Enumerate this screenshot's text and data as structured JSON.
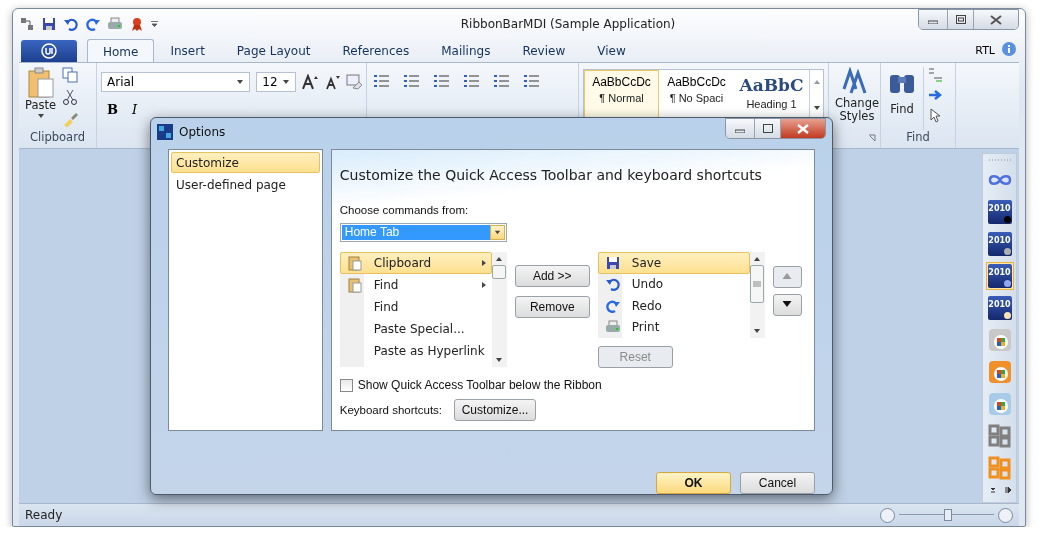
{
  "window": {
    "title": "RibbonBarMDI (Sample Application)"
  },
  "quick_access": [
    {
      "kind": "app"
    },
    {
      "kind": "save"
    },
    {
      "kind": "undo"
    },
    {
      "kind": "redo"
    },
    {
      "kind": "print"
    },
    {
      "kind": "award"
    },
    {
      "kind": "more"
    }
  ],
  "tabs": [
    {
      "label": "Home",
      "selected": true
    },
    {
      "label": "Insert",
      "selected": false
    },
    {
      "label": "Page Layout",
      "selected": false
    },
    {
      "label": "References",
      "selected": false
    },
    {
      "label": "Mailings",
      "selected": false
    },
    {
      "label": "Review",
      "selected": false
    },
    {
      "label": "View",
      "selected": false
    }
  ],
  "rtl_label": "RTL",
  "ribbon": {
    "clipboard": {
      "paste": "Paste",
      "label": "Clipboard"
    },
    "font": {
      "name": "Arial",
      "size": "12",
      "bold": "B",
      "italic": "I"
    },
    "styles": [
      {
        "sample": "AaBbCcDc",
        "name": "¶ Normal",
        "kind": "plain",
        "selected": true
      },
      {
        "sample": "AaBbCcDc",
        "name": "¶ No Spaci",
        "kind": "plain",
        "selected": false
      },
      {
        "sample": "AaBbC",
        "name": "Heading 1",
        "kind": "heading",
        "selected": false
      }
    ],
    "change_styles": "Change Styles",
    "find": {
      "button": "Find",
      "label": "Find"
    }
  },
  "dialog": {
    "title": "Options",
    "nav": [
      {
        "label": "Customize",
        "selected": true
      },
      {
        "label": "User-defined page",
        "selected": false
      }
    ],
    "heading": "Customize the Quick Access Toolbar and keyboard shortcuts",
    "source_label": "Choose commands from:",
    "source_value": "Home Tab",
    "commands": [
      {
        "label": "Clipboard",
        "kind": "clipboard",
        "submenu": true,
        "selected": true
      },
      {
        "label": "Find",
        "kind": "clipboard",
        "submenu": true,
        "selected": false
      },
      {
        "label": "Find",
        "kind": "plain",
        "submenu": false,
        "selected": false
      },
      {
        "label": "Paste Special...",
        "kind": "plain",
        "submenu": false,
        "selected": false
      },
      {
        "label": "Paste as Hyperlink",
        "kind": "plain",
        "submenu": false,
        "selected": false
      }
    ],
    "add_button": "Add >>",
    "remove_button": "Remove",
    "toolbar_items": [
      {
        "label": "Save",
        "kind": "save",
        "selected": true
      },
      {
        "label": "Undo",
        "kind": "undo",
        "selected": false
      },
      {
        "label": "Redo",
        "kind": "redo",
        "selected": false
      },
      {
        "label": "Print",
        "kind": "print",
        "selected": false
      }
    ],
    "reset": {
      "label": "Reset",
      "disabled": true
    },
    "move_up": {
      "disabled": true
    },
    "move_down": {
      "disabled": false
    },
    "below_ribbon": {
      "label": "Show Quick Access Toolbar below the Ribbon",
      "checked": false
    },
    "shortcuts_label": "Keyboard shortcuts:",
    "shortcuts_button": "Customize...",
    "ok": "OK",
    "cancel": "Cancel"
  },
  "palette": [
    {
      "kind": "infinity",
      "selected": false
    },
    {
      "kind": "theme",
      "label": "2010",
      "color": "#000000",
      "selected": false
    },
    {
      "kind": "theme",
      "label": "2010",
      "color": "#b0b0b0",
      "selected": false
    },
    {
      "kind": "theme",
      "label": "2010",
      "color": "#8fa8f0",
      "selected": true
    },
    {
      "kind": "theme",
      "label": "2010",
      "color": "#f8e4b0",
      "selected": false
    },
    {
      "kind": "office",
      "color": "#c8c8c8",
      "selected": false
    },
    {
      "kind": "office",
      "color": "#f0902a",
      "selected": false
    },
    {
      "kind": "office",
      "color": "#a8cce8",
      "selected": false
    },
    {
      "kind": "windows",
      "color": "#808080",
      "selected": false
    },
    {
      "kind": "windows",
      "color": "#f09020",
      "selected": false
    }
  ],
  "status_bar": {
    "text": "Ready",
    "zoom": {
      "level": 0.5
    }
  }
}
